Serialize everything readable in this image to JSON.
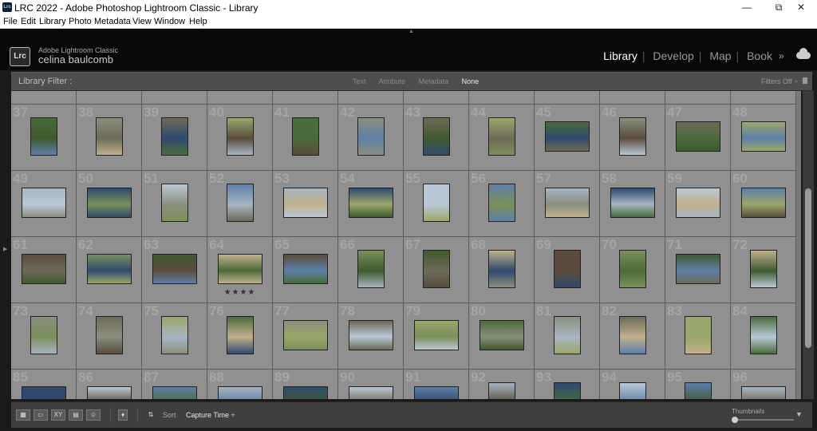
{
  "titlebar": {
    "title": "LRC 2022 - Adobe Photoshop Lightroom Classic - Library",
    "minimize": "—",
    "maximize": "⧉",
    "close": "✕",
    "app_icon": "Lrc"
  },
  "menu": [
    "File",
    "Edit",
    "Library",
    "Photo",
    "Metadata",
    "View",
    "Window",
    "Help"
  ],
  "identity": {
    "logo": "Lrc",
    "product": "Adobe Lightroom Classic",
    "user": "celina baulcomb"
  },
  "modules": [
    "Library",
    "Develop",
    "Map",
    "Book"
  ],
  "active_module": "Library",
  "module_more": "»",
  "filter": {
    "label": "Library Filter :",
    "options": [
      "Text",
      "Attribute",
      "Metadata",
      "None"
    ],
    "active": "None",
    "status": "Filters Off ÷"
  },
  "grid": {
    "columns": 12,
    "rows": [
      {
        "numbers": [
          "37",
          "38",
          "39",
          "40",
          "41",
          "42",
          "43",
          "44",
          "45",
          "46",
          "47",
          "48"
        ],
        "orient": [
          "p",
          "p",
          "p",
          "p",
          "p",
          "p",
          "p",
          "p",
          "l",
          "p",
          "l",
          "l"
        ]
      },
      {
        "numbers": [
          "49",
          "50",
          "51",
          "52",
          "53",
          "54",
          "55",
          "56",
          "57",
          "58",
          "59",
          "60"
        ],
        "orient": [
          "l",
          "l",
          "p",
          "p",
          "l",
          "l",
          "p",
          "p",
          "l",
          "l",
          "l",
          "l"
        ]
      },
      {
        "numbers": [
          "61",
          "62",
          "63",
          "64",
          "65",
          "66",
          "67",
          "68",
          "69",
          "70",
          "71",
          "72"
        ],
        "orient": [
          "l",
          "l",
          "l",
          "l",
          "l",
          "p",
          "p",
          "p",
          "p",
          "p",
          "l",
          "p"
        ]
      },
      {
        "numbers": [
          "73",
          "74",
          "75",
          "76",
          "77",
          "78",
          "79",
          "80",
          "81",
          "82",
          "83",
          "84"
        ],
        "orient": [
          "p",
          "p",
          "p",
          "p",
          "l",
          "l",
          "l",
          "l",
          "p",
          "p",
          "p",
          "p"
        ]
      },
      {
        "numbers": [
          "85",
          "86",
          "87",
          "88",
          "89",
          "90",
          "91",
          "92",
          "93",
          "94",
          "95",
          "96"
        ],
        "orient": [
          "l",
          "l",
          "l",
          "l",
          "l",
          "l",
          "l",
          "p",
          "p",
          "p",
          "p",
          "l"
        ]
      }
    ],
    "starred": {
      "number": "64",
      "stars": "★★★★"
    },
    "colors": [
      "#4a6b3a",
      "#7b8f5a",
      "#5d7fa8",
      "#8a8f7d",
      "#3e5a2e",
      "#a7b5c2",
      "#6e6a58",
      "#c1b08c",
      "#2f4a6e",
      "#9aa76a",
      "#5a4c3c",
      "#b9c8d6"
    ]
  },
  "toolbar": {
    "sort_label": "Sort",
    "sort_value": "Capture Time ÷",
    "thumbnails_label": "Thumbnails",
    "thumbnail_size": 0.0,
    "menu_arrow": "▼"
  }
}
